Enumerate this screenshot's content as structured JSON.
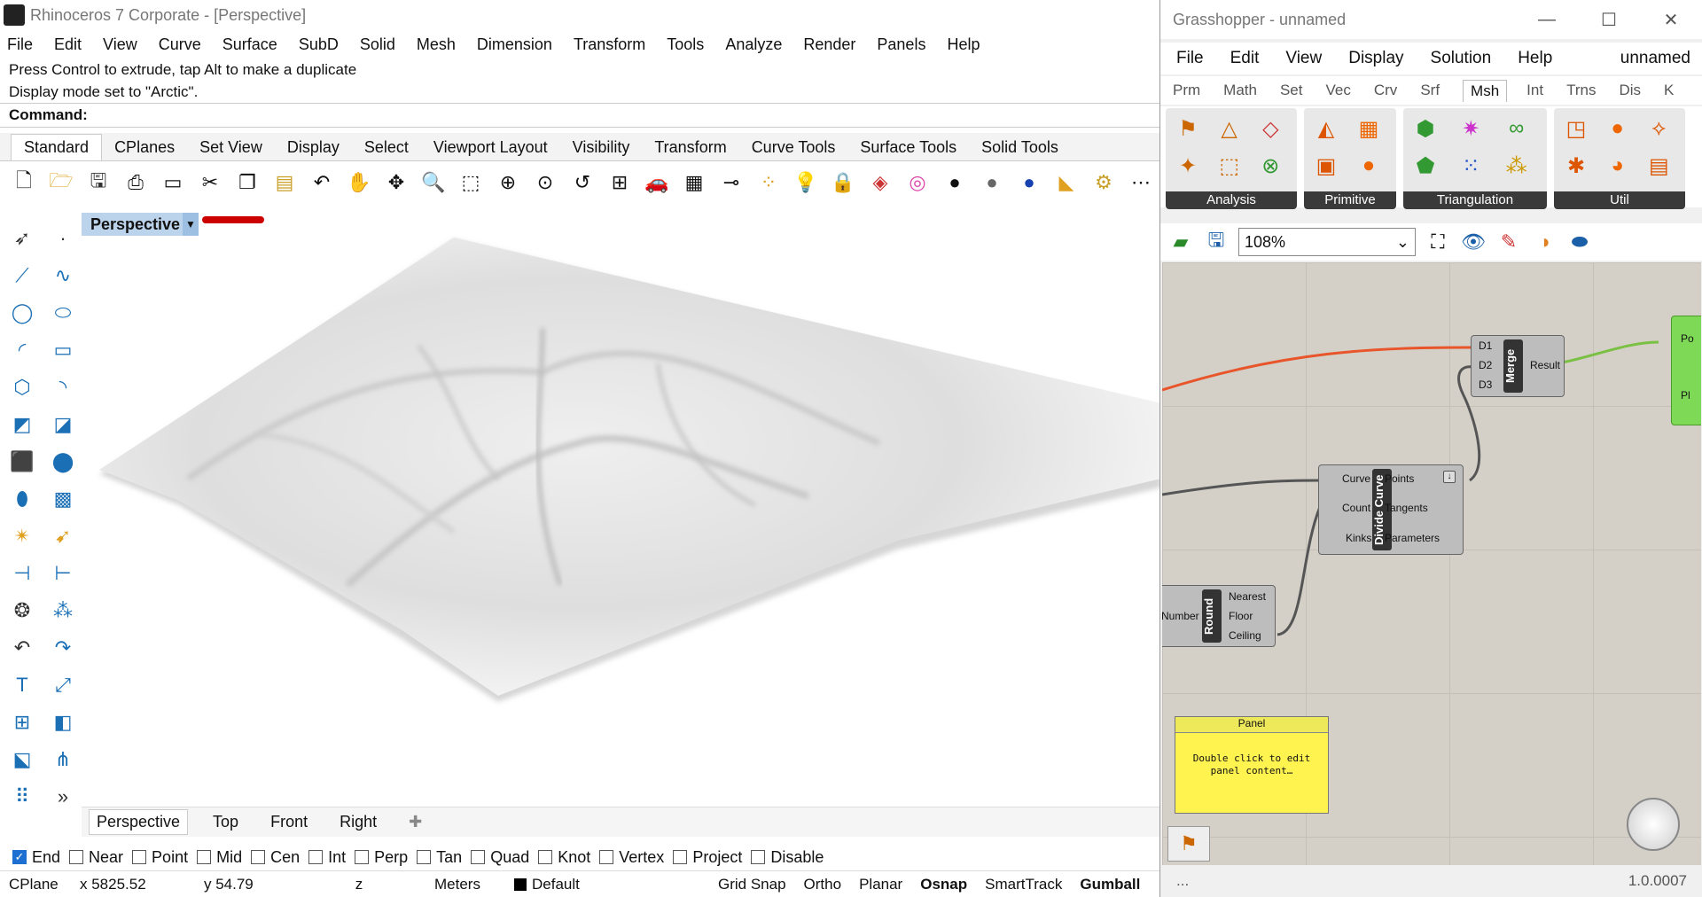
{
  "app": {
    "title": "Rhinoceros 7 Corporate - [Perspective]"
  },
  "menu": [
    "File",
    "Edit",
    "View",
    "Curve",
    "Surface",
    "SubD",
    "Solid",
    "Mesh",
    "Dimension",
    "Transform",
    "Tools",
    "Analyze",
    "Render",
    "Panels",
    "Help"
  ],
  "history": [
    "Press Control to extrude, tap Alt to make a duplicate",
    "Display mode set to \"Arctic\"."
  ],
  "command_label": "Command:",
  "toolbar_tabs": [
    "Standard",
    "CPlanes",
    "Set View",
    "Display",
    "Select",
    "Viewport Layout",
    "Visibility",
    "Transform",
    "Curve Tools",
    "Surface Tools",
    "Solid Tools"
  ],
  "viewport": {
    "label": "Perspective"
  },
  "viewport_tabs": [
    "Perspective",
    "Top",
    "Front",
    "Right"
  ],
  "osnaps": [
    {
      "label": "End",
      "checked": true
    },
    {
      "label": "Near",
      "checked": false
    },
    {
      "label": "Point",
      "checked": false
    },
    {
      "label": "Mid",
      "checked": false
    },
    {
      "label": "Cen",
      "checked": false
    },
    {
      "label": "Int",
      "checked": false
    },
    {
      "label": "Perp",
      "checked": false
    },
    {
      "label": "Tan",
      "checked": false
    },
    {
      "label": "Quad",
      "checked": false
    },
    {
      "label": "Knot",
      "checked": false
    },
    {
      "label": "Vertex",
      "checked": false
    },
    {
      "label": "Project",
      "checked": false
    },
    {
      "label": "Disable",
      "checked": false
    }
  ],
  "status": {
    "cplane": "CPlane",
    "x": "x 5825.52",
    "y": "y 54.79",
    "z": "z",
    "units": "Meters",
    "layer": "Default",
    "grid_snap": "Grid Snap",
    "ortho": "Ortho",
    "planar": "Planar",
    "osnap": "Osnap",
    "smarttrack": "SmartTrack",
    "gumball": "Gumball"
  },
  "gh": {
    "title": "Grasshopper - unnamed",
    "menu": [
      "File",
      "Edit",
      "View",
      "Display",
      "Solution",
      "Help"
    ],
    "doc_name": "unnamed",
    "tabs": [
      "Prm",
      "Math",
      "Set",
      "Vec",
      "Crv",
      "Srf",
      "Msh",
      "Int",
      "Trns",
      "Dis",
      "K"
    ],
    "groups": [
      "Analysis",
      "Primitive",
      "Triangulation",
      "Util"
    ],
    "zoom": "108%",
    "merge": {
      "name": "Merge",
      "inputs": [
        "D1",
        "D2",
        "D3"
      ],
      "output": "Result"
    },
    "divide": {
      "name": "Divide Curve",
      "inputs": [
        "Curve",
        "Count",
        "Kinks"
      ],
      "outputs": [
        "Points",
        "Tangents",
        "Parameters"
      ]
    },
    "round": {
      "name": "Round",
      "input": "Number",
      "outputs": [
        "Nearest",
        "Floor",
        "Ceiling"
      ]
    },
    "partial": {
      "outputs": [
        "Po",
        "Pl"
      ]
    },
    "panel": {
      "title": "Panel",
      "content": "Double click to edit panel content…"
    },
    "footer_left": "...",
    "version": "1.0.0007"
  }
}
